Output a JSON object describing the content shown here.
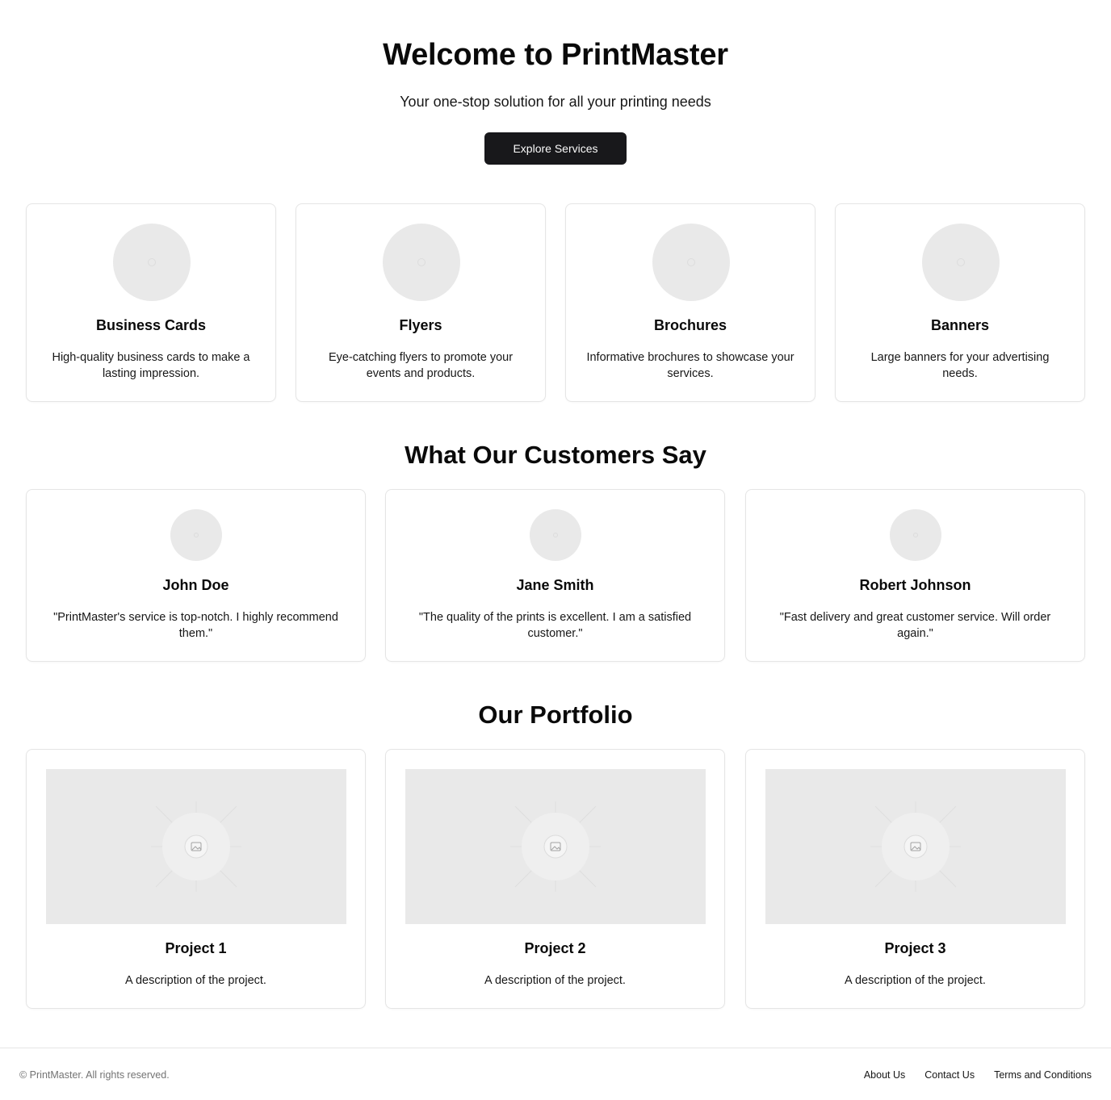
{
  "hero": {
    "title": "Welcome to PrintMaster",
    "subtitle": "Your one-stop solution for all your printing needs",
    "cta_label": "Explore Services"
  },
  "services": [
    {
      "title": "Business Cards",
      "description": "High-quality business cards to make a lasting impression.",
      "icon": "image-placeholder-icon"
    },
    {
      "title": "Flyers",
      "description": "Eye-catching flyers to promote your events and products.",
      "icon": "image-placeholder-icon"
    },
    {
      "title": "Brochures",
      "description": "Informative brochures to showcase your services.",
      "icon": "image-placeholder-icon"
    },
    {
      "title": "Banners",
      "description": "Large banners for your advertising needs.",
      "icon": "image-placeholder-icon"
    }
  ],
  "testimonials": {
    "heading": "What Our Customers Say",
    "items": [
      {
        "name": "John Doe",
        "quote": "\"PrintMaster's service is top-notch. I highly recommend them.\""
      },
      {
        "name": "Jane Smith",
        "quote": "\"The quality of the prints is excellent. I am a satisfied customer.\""
      },
      {
        "name": "Robert Johnson",
        "quote": "\"Fast delivery and great customer service. Will order again.\""
      }
    ]
  },
  "portfolio": {
    "heading": "Our Portfolio",
    "items": [
      {
        "title": "Project 1",
        "description": "A description of the project."
      },
      {
        "title": "Project 2",
        "description": "A description of the project."
      },
      {
        "title": "Project 3",
        "description": "A description of the project."
      }
    ]
  },
  "footer": {
    "copyright": "© PrintMaster. All rights reserved.",
    "links": [
      "About Us",
      "Contact Us",
      "Terms and Conditions"
    ]
  },
  "colors": {
    "primary_button": "#18181b",
    "placeholder": "#e9e9e9",
    "border": "#e5e5e5"
  }
}
